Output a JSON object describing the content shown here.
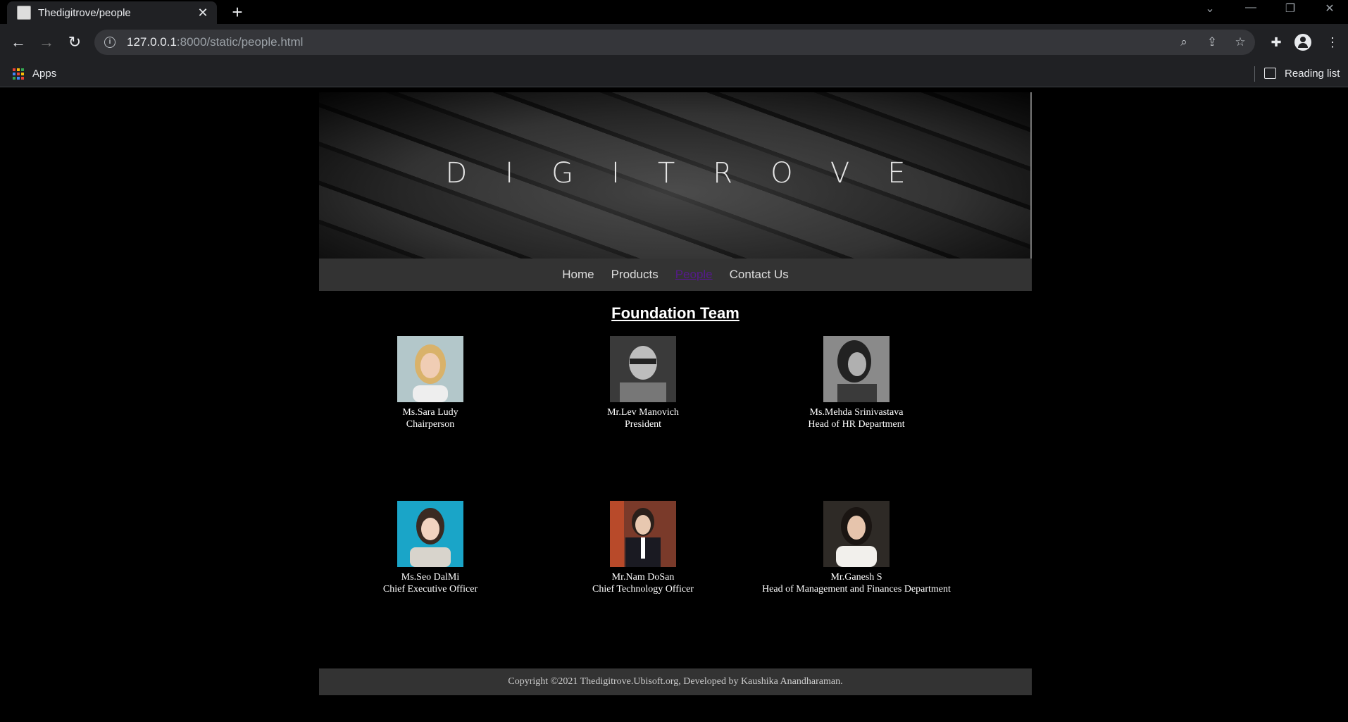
{
  "browser": {
    "tab_title": "Thedigitrove/people",
    "url_host": "127.0.0.1",
    "url_path": ":8000/static/people.html",
    "bookmarks": {
      "apps_label": "Apps",
      "reading_list_label": "Reading list"
    }
  },
  "site": {
    "brand": "DIGITROVE",
    "nav": [
      {
        "label": "Home"
      },
      {
        "label": "Products"
      },
      {
        "label": "People"
      },
      {
        "label": "Contact Us"
      }
    ],
    "active_nav": "People",
    "section_title": "Foundation Team",
    "members": [
      {
        "name": "Ms.Sara Ludy",
        "role": "Chairperson"
      },
      {
        "name": "Mr.Lev Manovich",
        "role": "President"
      },
      {
        "name": "Ms.Mehda Srinivastava",
        "role": "Head of HR Department"
      },
      {
        "name": "Ms.Seo DalMi",
        "role": "Chief Executive Officer"
      },
      {
        "name": "Mr.Nam DoSan",
        "role": "Chief Technology Officer"
      },
      {
        "name": "Mr.Ganesh S",
        "role": "Head of Management and Finances Department"
      }
    ],
    "footer": "Copyright ©2021 Thedigitrove.Ubisoft.org, Developed by Kaushika Anandharaman."
  }
}
